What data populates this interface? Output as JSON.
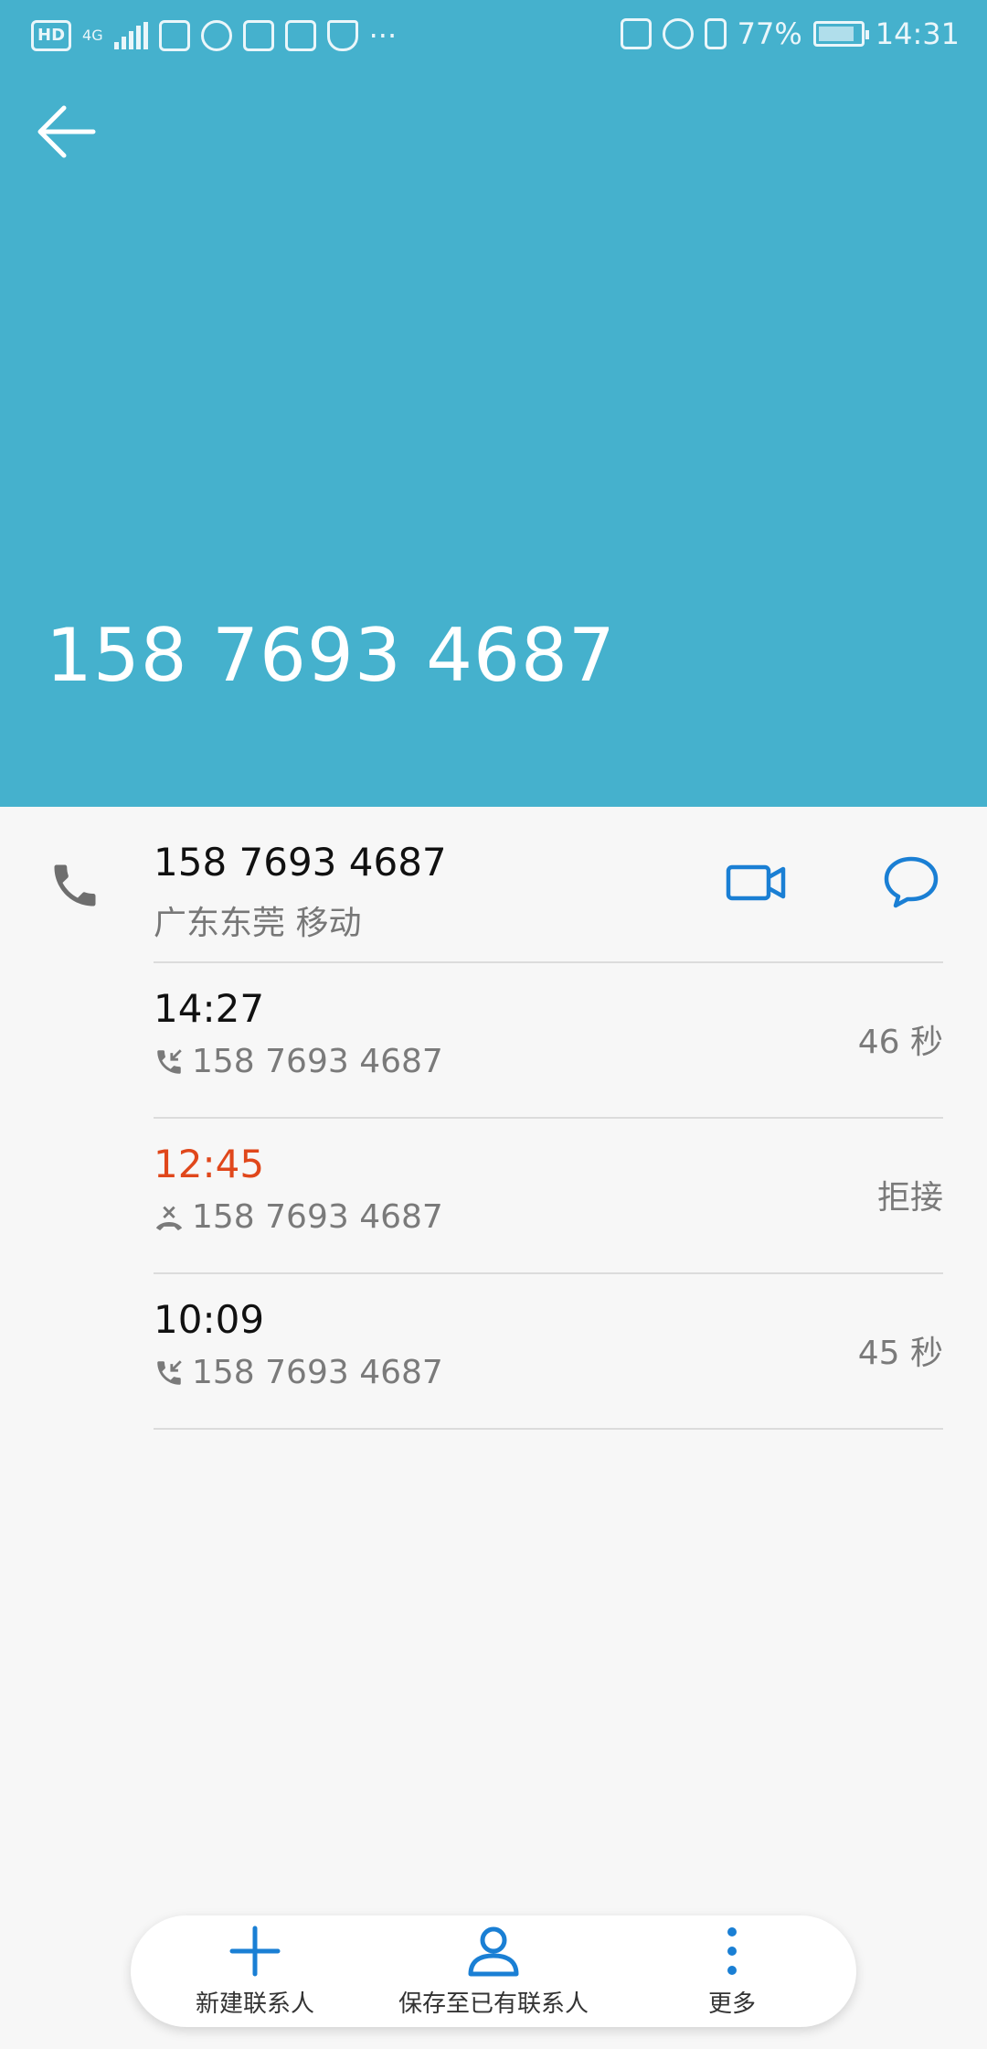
{
  "status_bar": {
    "hd_label": "HD",
    "network_label": "4G",
    "battery_percent": "77%",
    "time": "14:31",
    "more_label": "···"
  },
  "header": {
    "phone_number": "158 7693 4687"
  },
  "contact": {
    "number": "158 7693 4687",
    "location": "广东东莞 移动"
  },
  "calls": [
    {
      "time": "14:27",
      "number": "158 7693 4687",
      "status": "46 秒",
      "type": "incoming",
      "missed": false
    },
    {
      "time": "12:45",
      "number": "158 7693 4687",
      "status": "拒接",
      "type": "rejected",
      "missed": true
    },
    {
      "time": "10:09",
      "number": "158 7693 4687",
      "status": "45 秒",
      "type": "incoming",
      "missed": false
    }
  ],
  "bottom_actions": {
    "new_contact": "新建联系人",
    "save_existing": "保存至已有联系人",
    "more": "更多"
  },
  "colors": {
    "header_bg": "#45b1cd",
    "accent": "#1a7fd4",
    "missed": "#e0471b"
  }
}
